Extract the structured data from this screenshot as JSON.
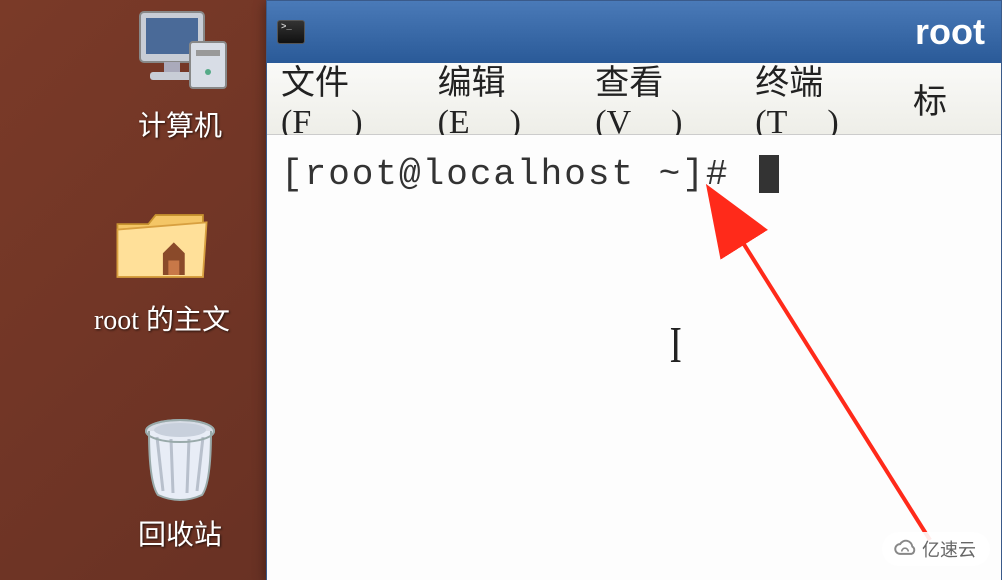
{
  "desktop": {
    "icons": {
      "computer": {
        "label": "计算机"
      },
      "home_folder": {
        "label": "root 的主文"
      },
      "trash": {
        "label": "回收站"
      }
    }
  },
  "window": {
    "title": "root",
    "menubar": {
      "file": {
        "label": "文件",
        "mnemonic": "F"
      },
      "edit": {
        "label": "编辑",
        "mnemonic": "E"
      },
      "view": {
        "label": "查看",
        "mnemonic": "V"
      },
      "terminal": {
        "label": "终端",
        "mnemonic": "T"
      },
      "help_partial": {
        "label": "标"
      }
    },
    "terminal": {
      "prompt": "[root@localhost ~]# "
    }
  },
  "watermark": {
    "text": "亿速云"
  },
  "colors": {
    "titlebar_start": "#4a7ab8",
    "titlebar_end": "#2a5a98",
    "arrow": "#ff2a1a",
    "desktop_bg": "#6a3224"
  }
}
